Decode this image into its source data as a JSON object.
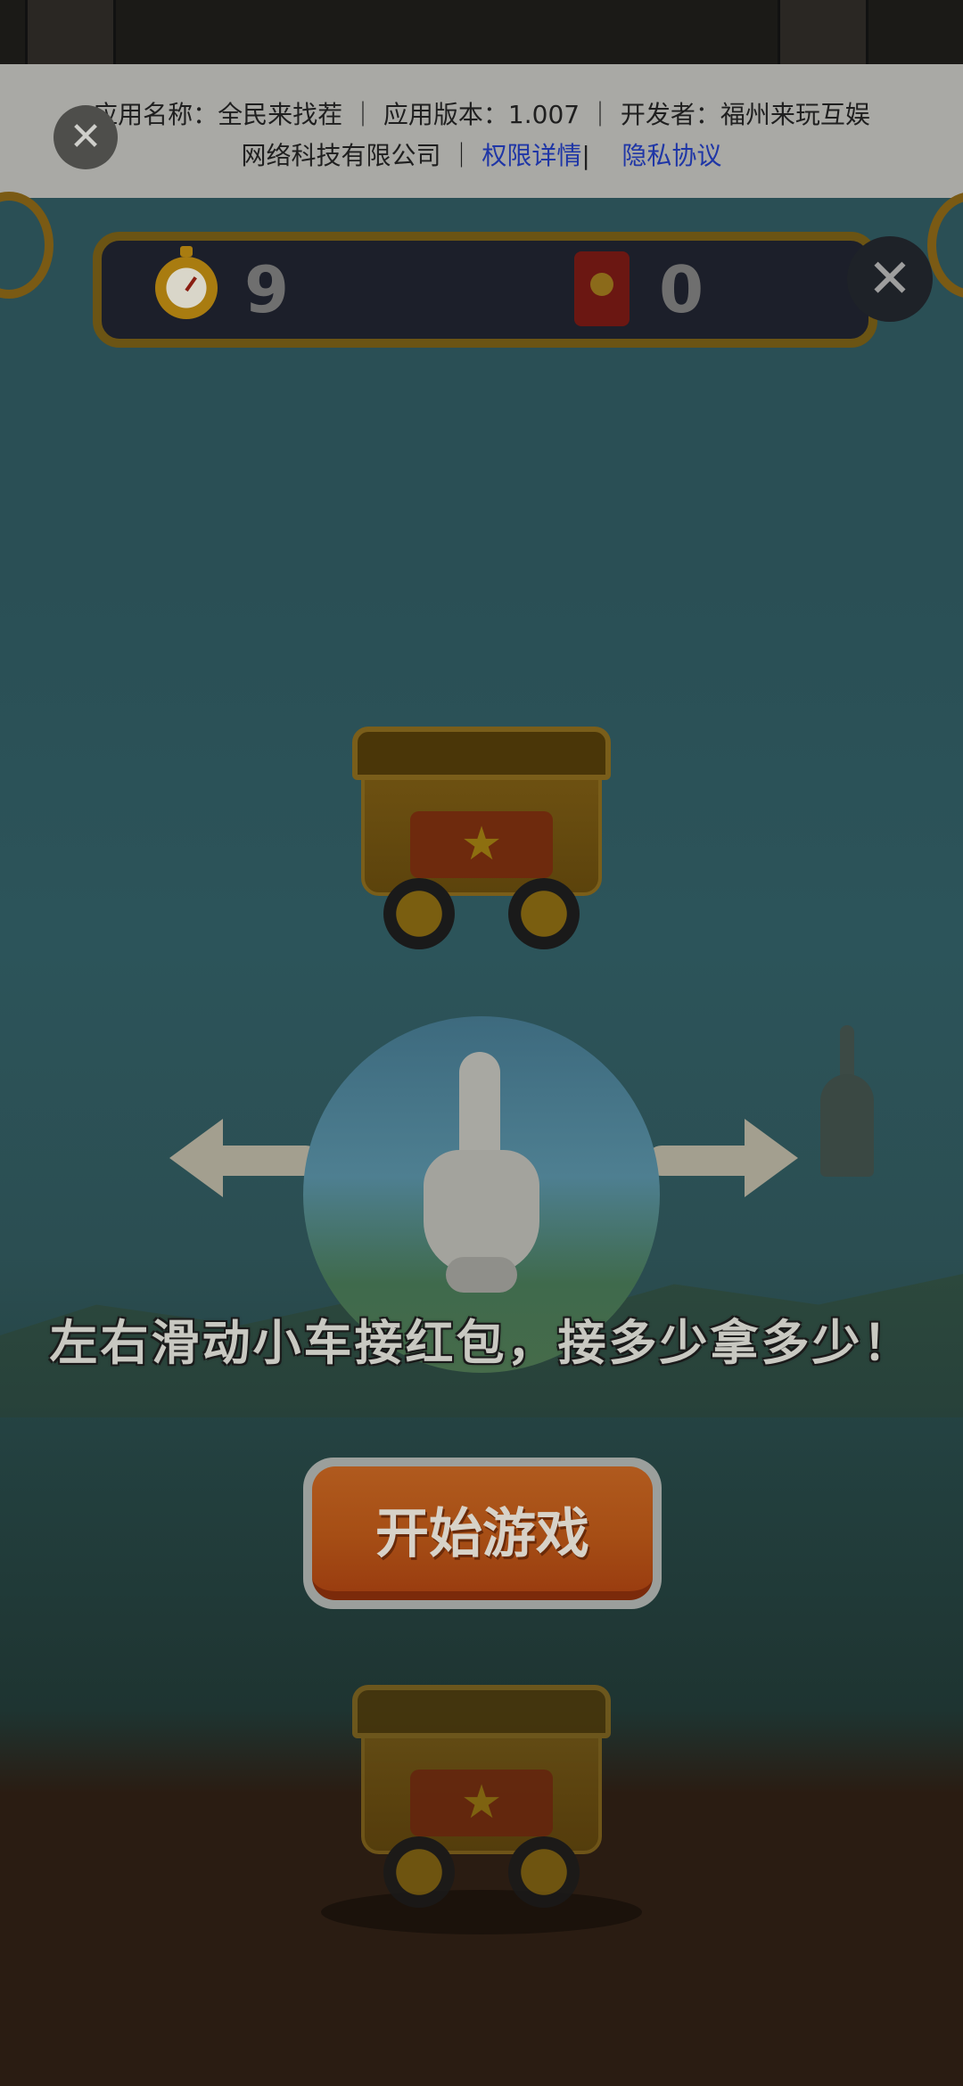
{
  "info_banner": {
    "line1": "应用名称：全民来找茬 ｜ 应用版本：1.007 ｜ 开发者：福州来玩互娱",
    "line2_prefix": "网络科技有限公司 ｜ ",
    "permissions_link": "权限详情",
    "separator": "|",
    "privacy_link": "隐私协议",
    "close_icon": "close-icon"
  },
  "hud": {
    "timer_icon": "stopwatch-icon",
    "timer_value": "9",
    "redpacket_icon": "red-envelope-icon",
    "redpacket_count": "0",
    "close_icon": "close-icon"
  },
  "tutorial": {
    "cart_icon": "mine-cart-icon",
    "hand_icon": "pointing-hand-icon",
    "left_arrow_icon": "curved-arrow-left-icon",
    "right_arrow_icon": "curved-arrow-right-icon",
    "instruction": "左右滑动小车接红包，接多少拿多少！",
    "star_glyph": "★"
  },
  "start_button": {
    "label": "开始游戏"
  },
  "close_glyph": "✕"
}
